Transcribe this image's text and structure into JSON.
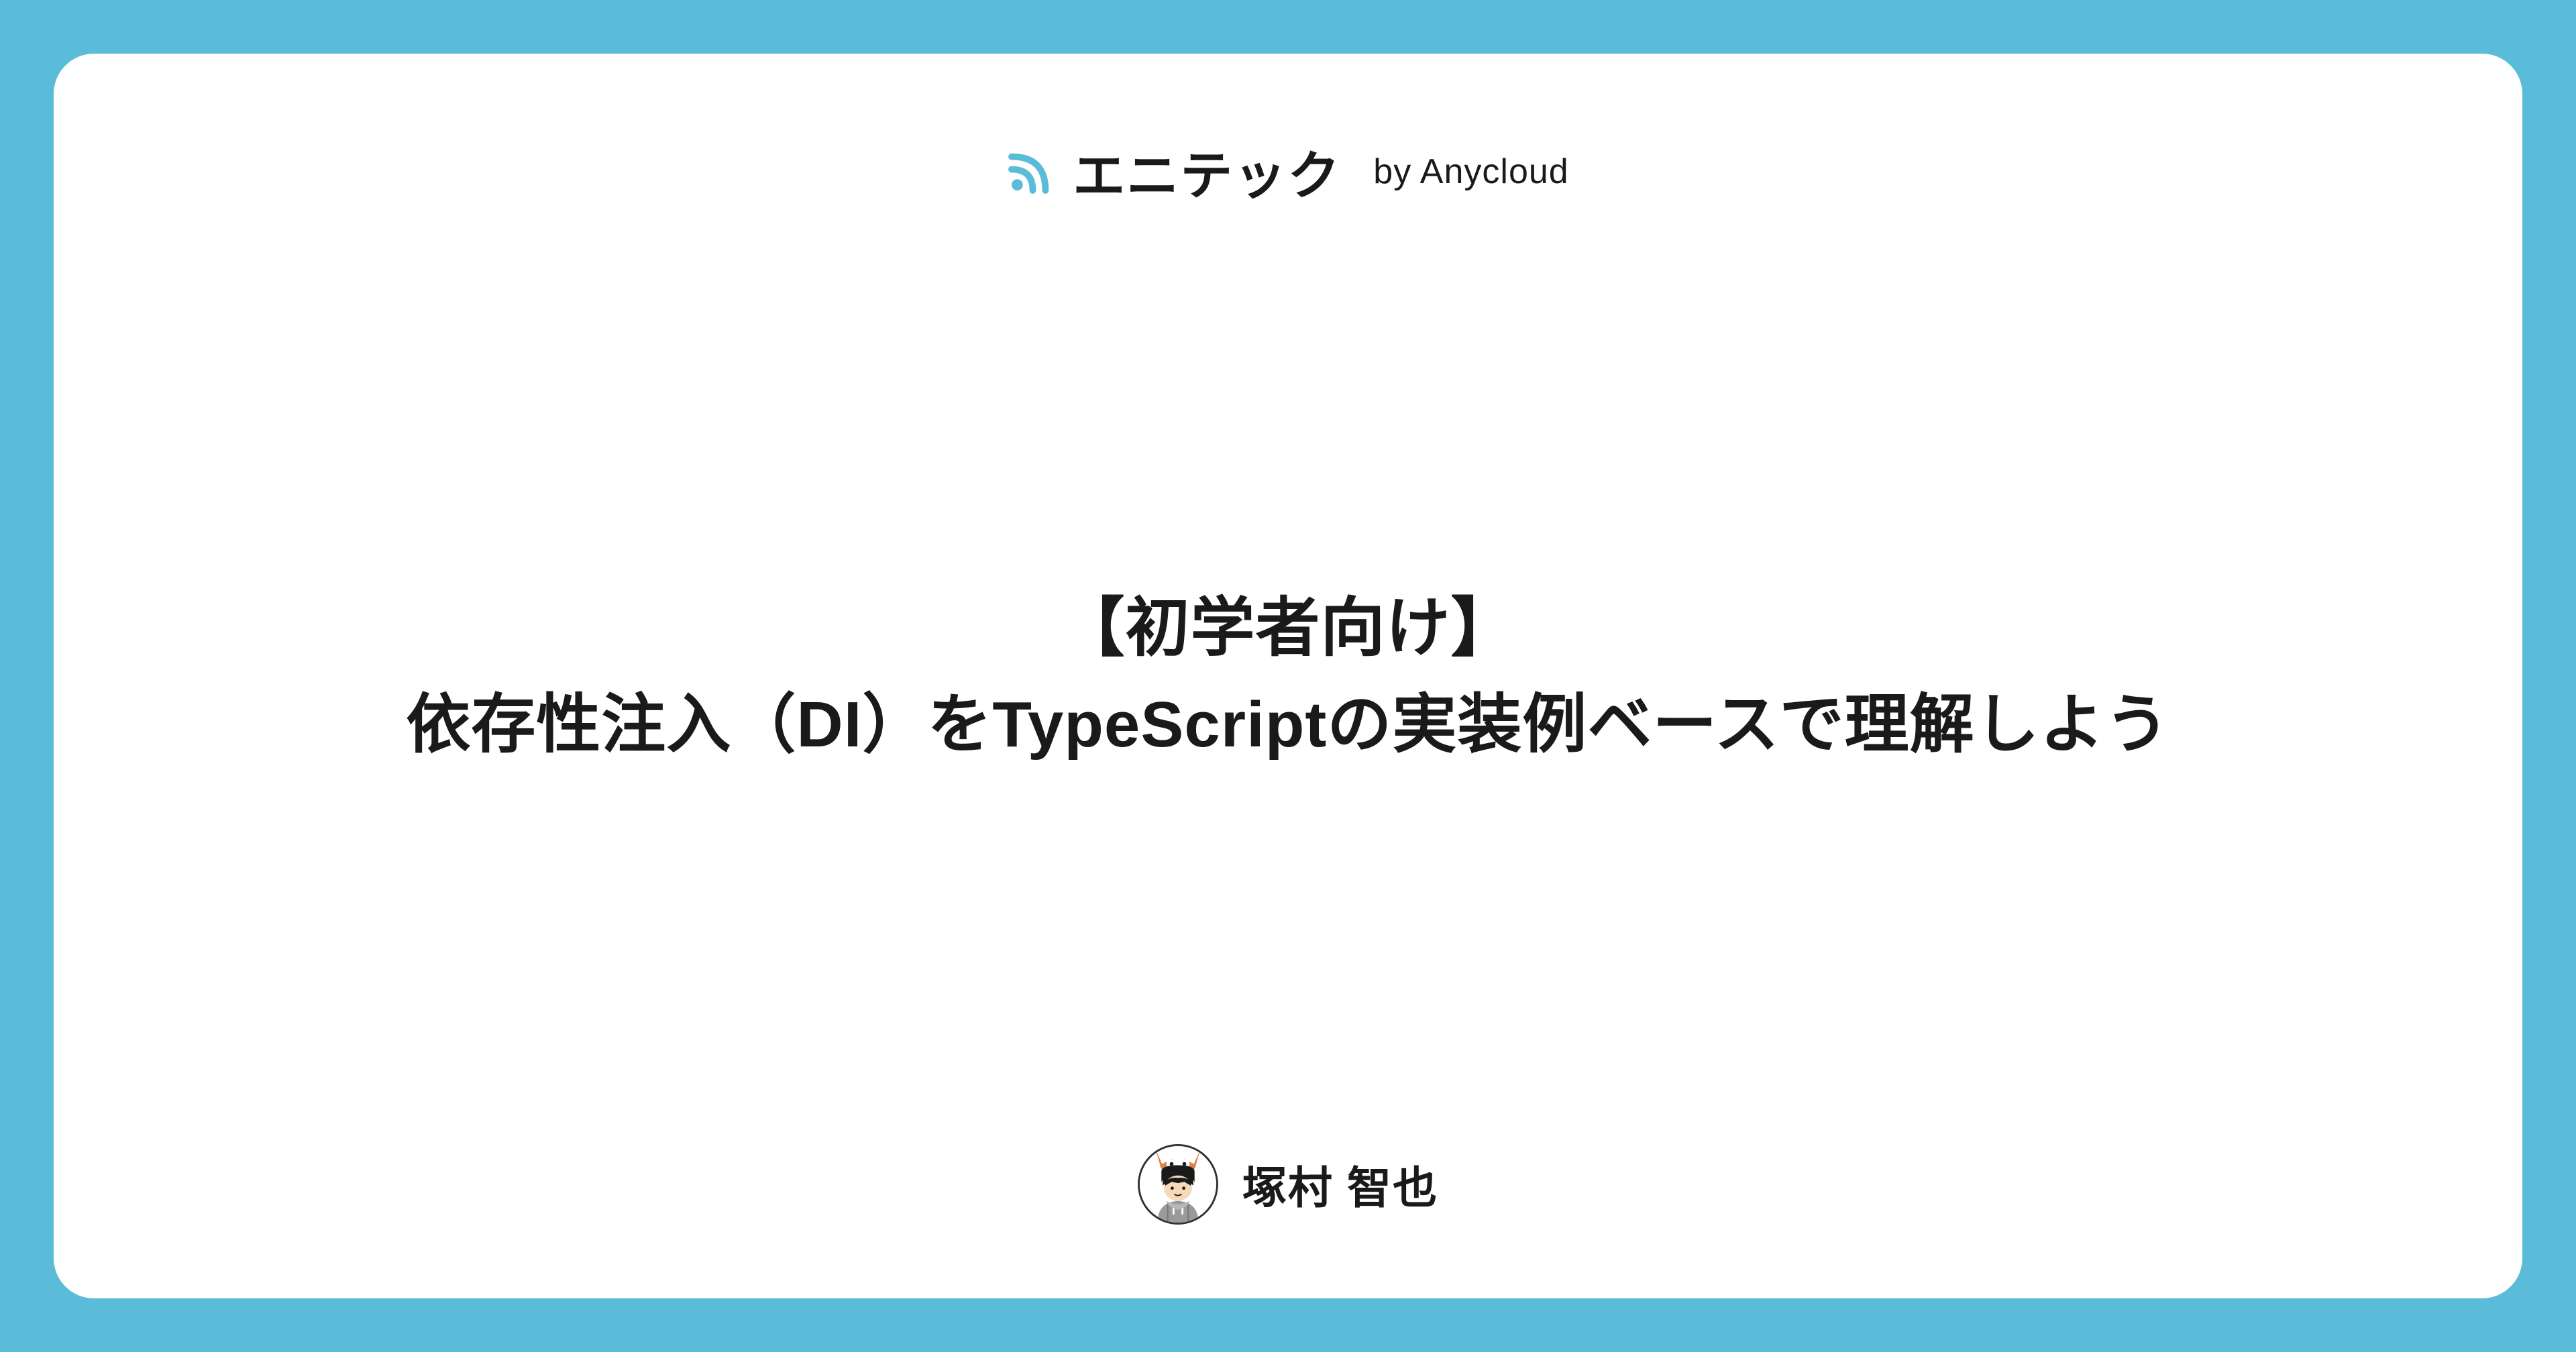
{
  "header": {
    "brand_name": "エニテック",
    "brand_suffix": "by Anycloud"
  },
  "title": {
    "line1": "【初学者向け】",
    "line2": "依存性注入（DI）をTypeScriptの実装例ベースで理解しよう"
  },
  "author": {
    "name": "塚村 智也"
  }
}
